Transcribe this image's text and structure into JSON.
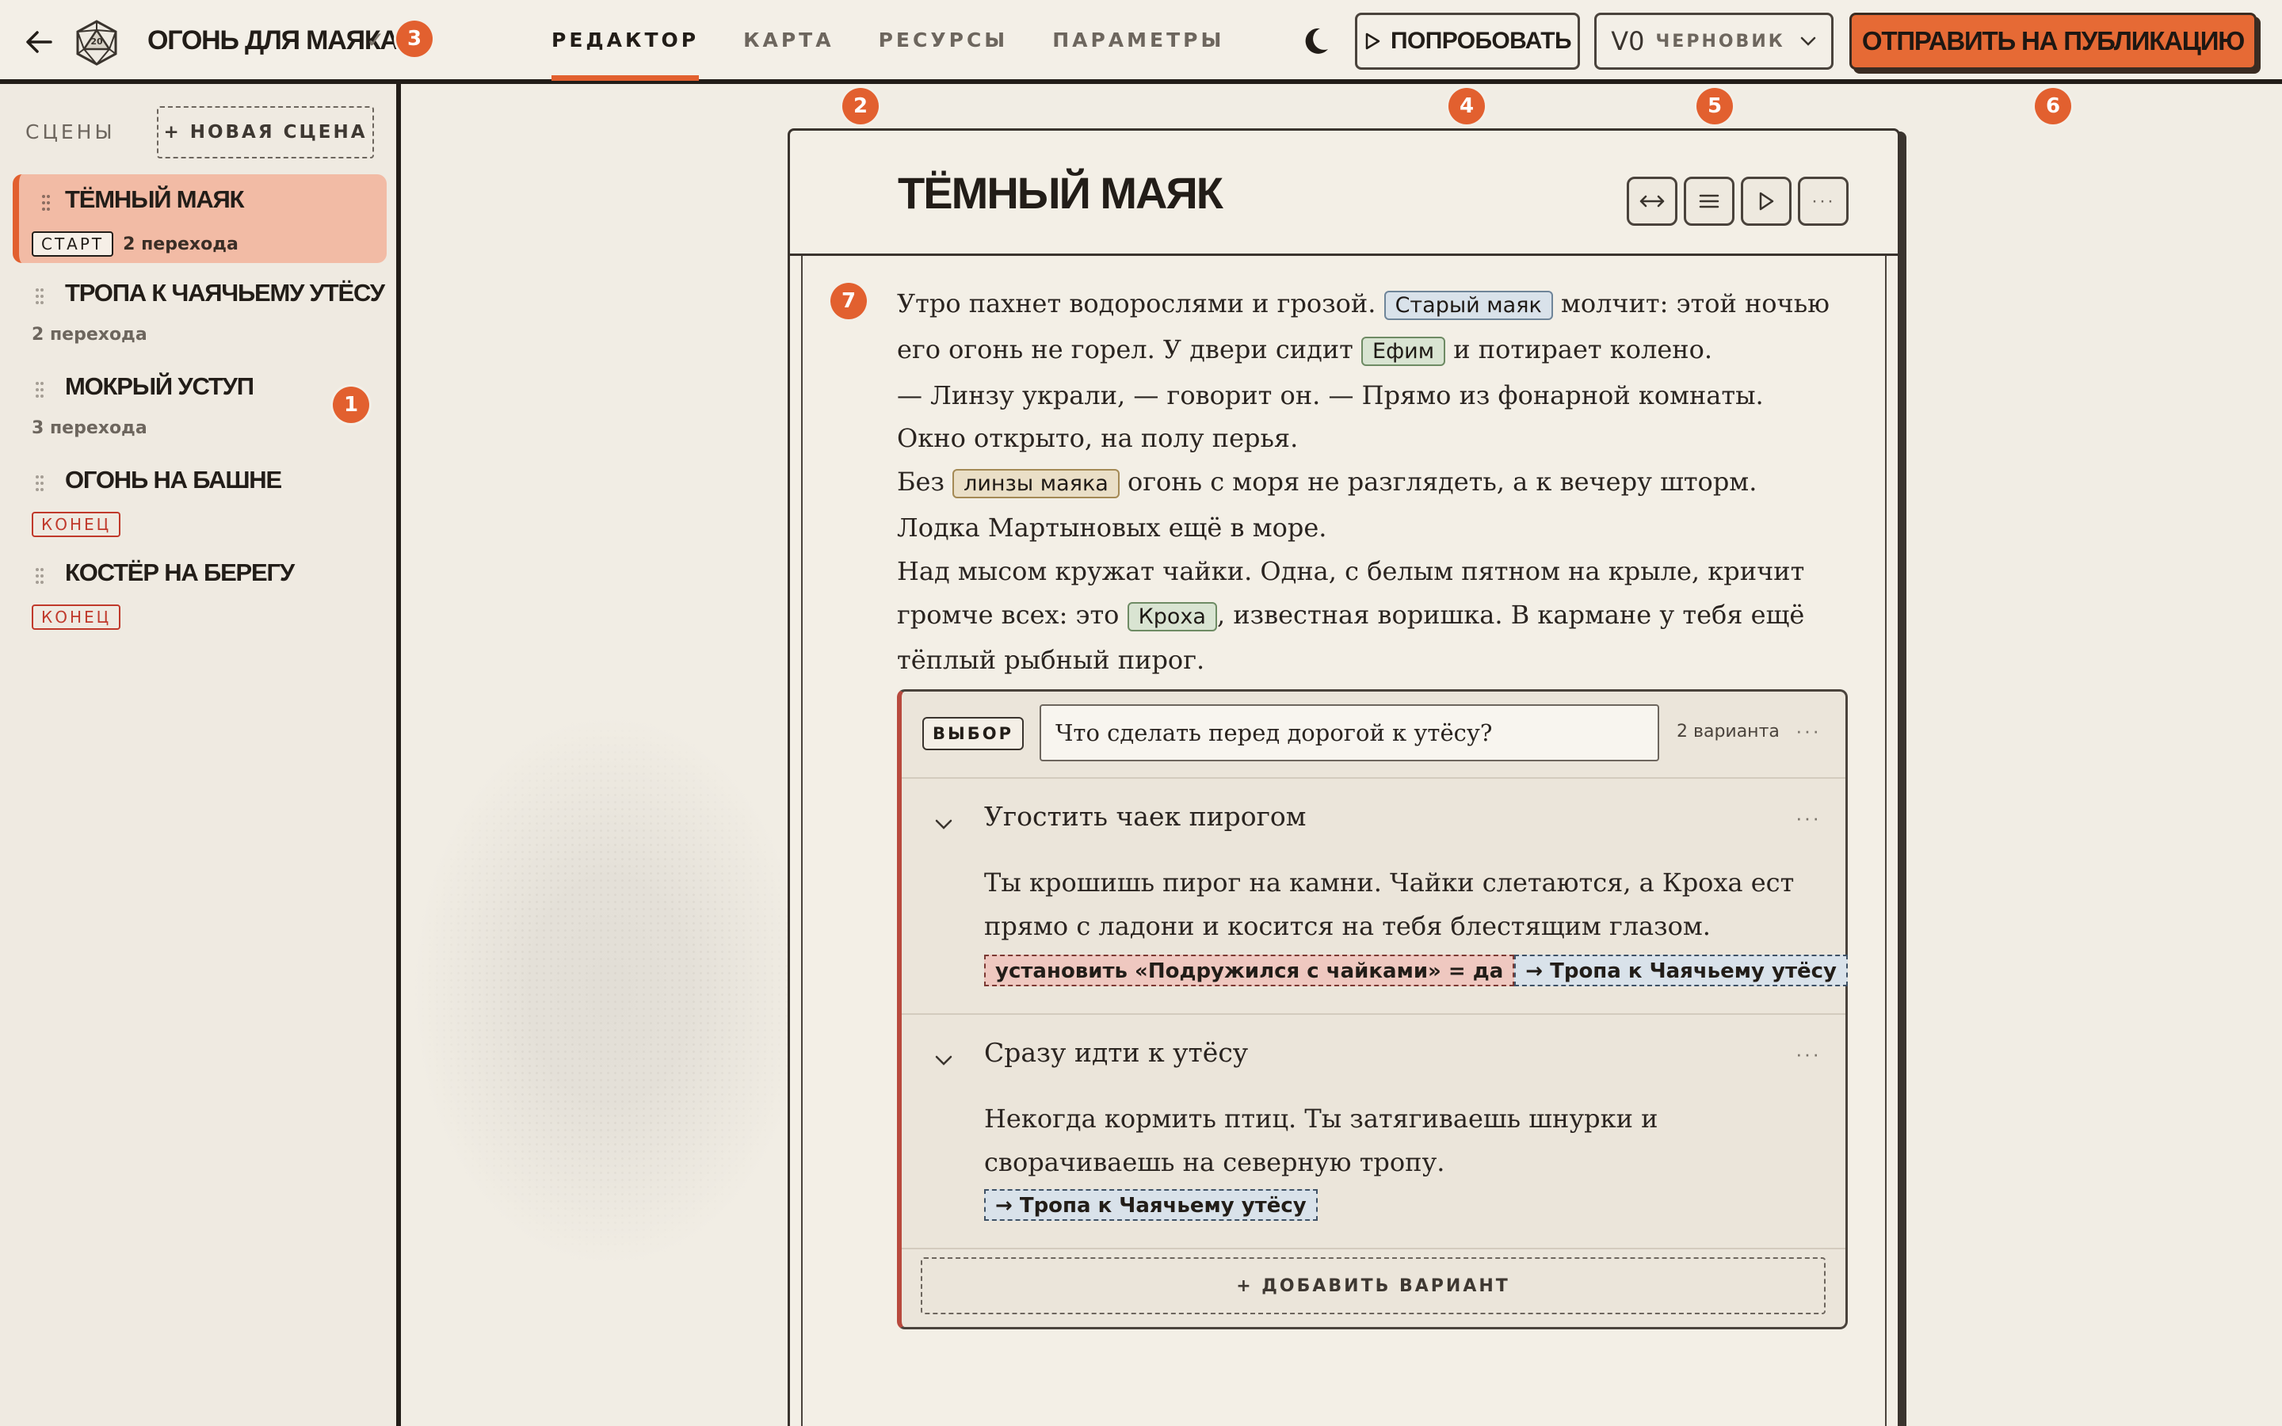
{
  "header": {
    "project_title": "ОГОНЬ ДЛЯ МАЯКА",
    "tabs": [
      {
        "label": "РЕДАКТОР",
        "active": true
      },
      {
        "label": "КАРТА",
        "active": false
      },
      {
        "label": "РЕСУРСЫ",
        "active": false
      },
      {
        "label": "ПАРАМЕТРЫ",
        "active": false
      }
    ],
    "try_label": "ПОПРОБОВАТЬ",
    "version_number": "V0",
    "version_status": "ЧЕРНОВИК",
    "publish_label": "ОТПРАВИТЬ НА ПУБЛИКАЦИЮ"
  },
  "sidebar": {
    "heading": "СЦЕНЫ",
    "new_scene_label": "+ НОВАЯ СЦЕНА",
    "scenes": [
      {
        "name": "ТЁМНЫЙ МАЯК",
        "tag": "СТАРТ",
        "transitions": "2 перехода",
        "active": true
      },
      {
        "name": "ТРОПА К ЧАЯЧЬЕМУ УТЁСУ",
        "transitions": "2 перехода"
      },
      {
        "name": "МОКРЫЙ УСТУП",
        "transitions": "3 перехода"
      },
      {
        "name": "ОГОНЬ НА БАШНЕ",
        "tag": "КОНЕЦ"
      },
      {
        "name": "КОСТЁР НА БЕРЕГУ",
        "tag": "КОНЕЦ"
      }
    ]
  },
  "badges": [
    "1",
    "2",
    "3",
    "4",
    "5",
    "6",
    "7"
  ],
  "editor": {
    "scene_title": "ТЁМНЫЙ МАЯК",
    "prose": {
      "p1_a": "Утро пахнет водорослями и грозой. ",
      "chip_lighthouse": "Старый маяк",
      "p1_b": " молчит: этой ночью его огонь не горел. У двери сидит ",
      "chip_efim": "Ефим",
      "p1_c": " и потирает колено.",
      "p2": "— Линзу украли, — говорит он. — Прямо из фонарной комнаты. Окно открыто, на полу перья.",
      "p3_a": "Без ",
      "chip_lens": "линзы маяка",
      "p3_b": " огонь с моря не разглядеть, а к вечеру шторм. Лодка Мартыновых ещё в море.",
      "p4_a": "Над мысом кружат чайки. Одна, с белым пятном на крыле, кричит громче всех: это ",
      "chip_kroha": "Кроха",
      "p4_b": ", известная воришка. В кармане у тебя ещё тёплый рыбный пирог."
    },
    "choice": {
      "tag": "ВЫБОР",
      "question": "Что сделать перед дорогой к утёсу?",
      "count": "2 варианта",
      "options": [
        {
          "title": "Угостить чаек пирогом",
          "body": "Ты крошишь пирог на камни. Чайки слетаются, а Кроха ест прямо с ладони и косится на тебя блестящим глазом.",
          "effect_set": "установить «Подружился с чайками» = да",
          "effect_go": "→ Тропа к Чаячьему утёсу"
        },
        {
          "title": "Сразу идти к утёсу",
          "body": "Некогда кормить птиц. Ты затягиваешь шнурки и сворачиваешь на северную тропу.",
          "effect_go": "→ Тропа к Чаячьему утёсу"
        }
      ],
      "add_label": "+ ДОБАВИТЬ ВАРИАНТ"
    },
    "more_glyph": "···"
  },
  "colors": {
    "accent": "#e2602f",
    "publish_bg": "#e66a35",
    "active_scene_bg": "#f2bba5",
    "background": "#f1ede4",
    "ink": "#221d18"
  },
  "icons": [
    "back-arrow-icon",
    "d20-dice-icon",
    "check-icon",
    "moon-icon",
    "play-icon",
    "chevron-down-icon",
    "drag-handle-icon",
    "expand-width-icon",
    "list-icon",
    "more-icon"
  ]
}
